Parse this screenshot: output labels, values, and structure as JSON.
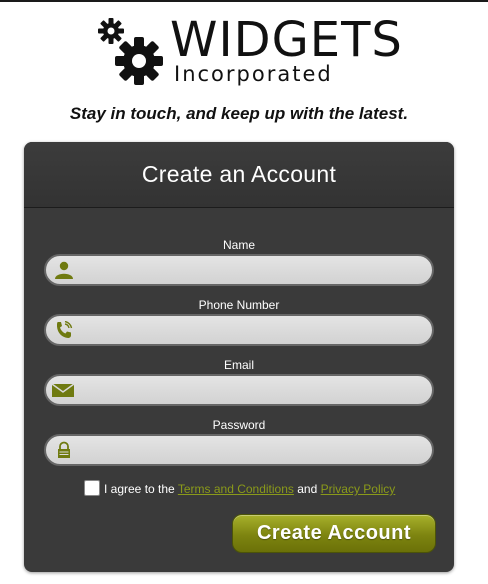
{
  "logo": {
    "name": "WIDGETS",
    "sub": "Incorporated"
  },
  "tagline": "Stay in touch, and keep up with the latest.",
  "form": {
    "title": "Create an Account",
    "fields": [
      {
        "label": "Name",
        "icon": "user-icon",
        "value": ""
      },
      {
        "label": "Phone Number",
        "icon": "phone-icon",
        "value": ""
      },
      {
        "label": "Email",
        "icon": "envelope-icon",
        "value": ""
      },
      {
        "label": "Password",
        "icon": "lock-icon",
        "value": ""
      }
    ],
    "agree": {
      "prefix": "I agree to the",
      "terms": "Terms and Conditions",
      "and": "and",
      "privacy": "Privacy Policy",
      "checked": false
    },
    "submit_label": "Create Account"
  },
  "colors": {
    "accent": "#7d8410",
    "card": "#3a3a3a",
    "link": "#8a9a1a"
  }
}
